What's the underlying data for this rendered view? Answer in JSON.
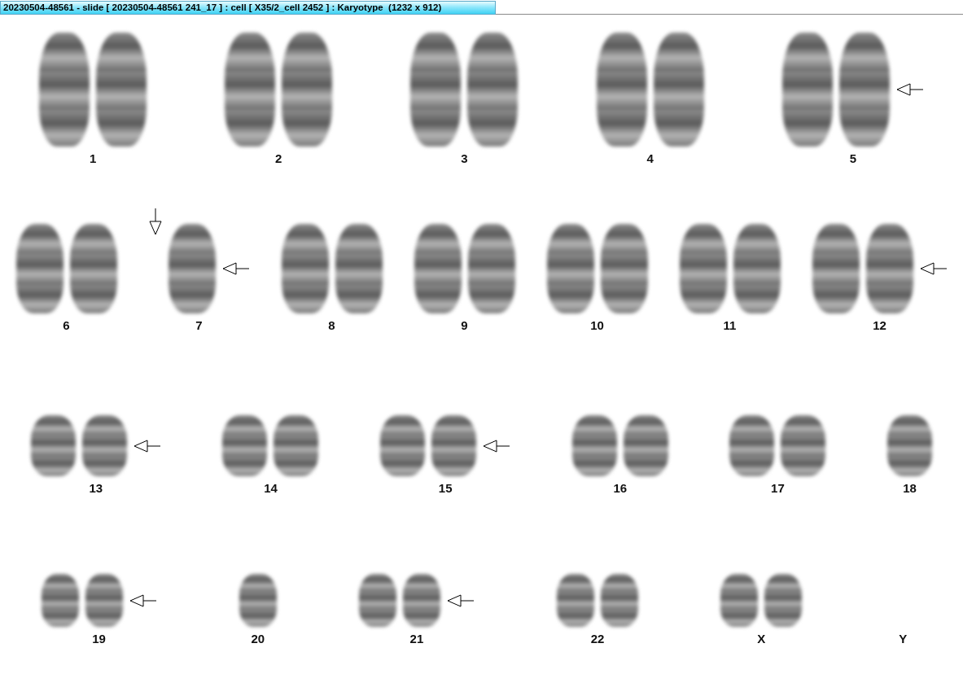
{
  "window": {
    "title": "20230504-48561 - slide [ 20230504-48561 241_17 ] : cell [ X35/2_cell 2452 ] : Karyotype  (1232 x 912)"
  },
  "rows": [
    {
      "groups": [
        {
          "label": "1",
          "chromosomes": [
            {
              "kind": "chromosome"
            },
            {
              "kind": "chromosome"
            }
          ],
          "arrow_down": false,
          "arrow_left": false
        },
        {
          "label": "2",
          "chromosomes": [
            {
              "kind": "chromosome"
            },
            {
              "kind": "chromosome"
            }
          ],
          "arrow_down": false,
          "arrow_left": false
        },
        {
          "label": "3",
          "chromosomes": [
            {
              "kind": "chromosome"
            },
            {
              "kind": "chromosome"
            }
          ],
          "arrow_down": false,
          "arrow_left": false
        },
        {
          "label": "4",
          "chromosomes": [
            {
              "kind": "chromosome"
            },
            {
              "kind": "chromosome"
            }
          ],
          "arrow_down": false,
          "arrow_left": false
        },
        {
          "label": "5",
          "chromosomes": [
            {
              "kind": "chromosome"
            },
            {
              "kind": "chromosome"
            }
          ],
          "arrow_down": false,
          "arrow_left": true
        }
      ]
    },
    {
      "groups": [
        {
          "label": "6",
          "chromosomes": [
            {
              "kind": "chromosome"
            },
            {
              "kind": "chromosome"
            }
          ],
          "arrow_down": false,
          "arrow_left": false
        },
        {
          "label": "7",
          "chromosomes": [
            {
              "kind": "chromosome"
            }
          ],
          "arrow_down": true,
          "arrow_left": true
        },
        {
          "label": "8",
          "chromosomes": [
            {
              "kind": "chromosome"
            },
            {
              "kind": "chromosome"
            }
          ],
          "arrow_down": false,
          "arrow_left": false
        },
        {
          "label": "9",
          "chromosomes": [
            {
              "kind": "chromosome"
            },
            {
              "kind": "chromosome"
            }
          ],
          "arrow_down": false,
          "arrow_left": false
        },
        {
          "label": "10",
          "chromosomes": [
            {
              "kind": "chromosome"
            },
            {
              "kind": "chromosome"
            }
          ],
          "arrow_down": false,
          "arrow_left": false
        },
        {
          "label": "11",
          "chromosomes": [
            {
              "kind": "chromosome"
            },
            {
              "kind": "chromosome"
            }
          ],
          "arrow_down": false,
          "arrow_left": false
        },
        {
          "label": "12",
          "chromosomes": [
            {
              "kind": "chromosome"
            },
            {
              "kind": "chromosome"
            }
          ],
          "arrow_down": false,
          "arrow_left": true
        }
      ]
    },
    {
      "groups": [
        {
          "label": "13",
          "chromosomes": [
            {
              "kind": "chromosome"
            },
            {
              "kind": "chromosome"
            }
          ],
          "arrow_down": false,
          "arrow_left": true
        },
        {
          "label": "14",
          "chromosomes": [
            {
              "kind": "chromosome"
            },
            {
              "kind": "chromosome"
            }
          ],
          "arrow_down": false,
          "arrow_left": false
        },
        {
          "label": "15",
          "chromosomes": [
            {
              "kind": "chromosome"
            },
            {
              "kind": "chromosome"
            }
          ],
          "arrow_down": false,
          "arrow_left": true
        },
        {
          "label": "16",
          "chromosomes": [
            {
              "kind": "chromosome"
            },
            {
              "kind": "chromosome"
            }
          ],
          "arrow_down": false,
          "arrow_left": false
        },
        {
          "label": "17",
          "chromosomes": [
            {
              "kind": "chromosome"
            },
            {
              "kind": "chromosome"
            }
          ],
          "arrow_down": false,
          "arrow_left": false
        },
        {
          "label": "18",
          "chromosomes": [
            {
              "kind": "chromosome"
            }
          ],
          "arrow_down": false,
          "arrow_left": false
        }
      ]
    },
    {
      "groups": [
        {
          "label": "19",
          "chromosomes": [
            {
              "kind": "chromosome"
            },
            {
              "kind": "chromosome"
            }
          ],
          "arrow_down": false,
          "arrow_left": true
        },
        {
          "label": "20",
          "chromosomes": [
            {
              "kind": "chromosome"
            }
          ],
          "arrow_down": false,
          "arrow_left": false
        },
        {
          "label": "21",
          "chromosomes": [
            {
              "kind": "chromosome"
            },
            {
              "kind": "chromosome"
            }
          ],
          "arrow_down": false,
          "arrow_left": true
        },
        {
          "label": "22",
          "chromosomes": [
            {
              "kind": "chromosome"
            },
            {
              "kind": "chromosome"
            }
          ],
          "arrow_down": false,
          "arrow_left": false
        },
        {
          "label": "X",
          "chromosomes": [
            {
              "kind": "chromosome"
            },
            {
              "kind": "chromosome"
            }
          ],
          "arrow_down": false,
          "arrow_left": false
        },
        {
          "label": "Y",
          "arrow_down": false,
          "arrow_left": false
        }
      ]
    }
  ]
}
